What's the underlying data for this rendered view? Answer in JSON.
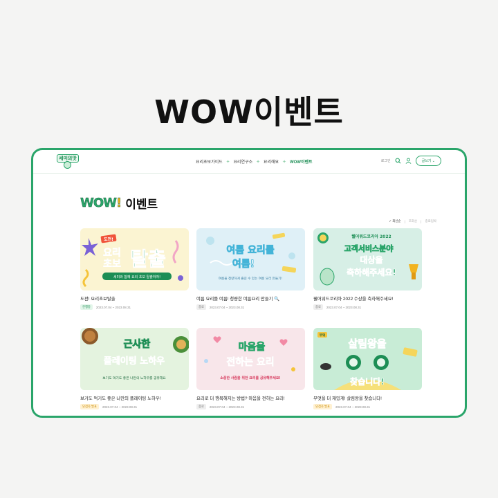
{
  "hero": {
    "title": "WOW이벤트"
  },
  "nav": {
    "logo_text": "세미의맛",
    "menu": [
      {
        "label": "요리초보가이드"
      },
      {
        "label": "요리연구소"
      },
      {
        "label": "요리해요"
      },
      {
        "label": "WOW이벤트"
      }
    ],
    "login": "로그인",
    "cta": "글쓰기"
  },
  "page": {
    "wow_badge": "WOW",
    "wow_ex": "!",
    "title": "이벤트"
  },
  "sort": {
    "options": [
      "최신순",
      "조회순",
      "종료임박"
    ]
  },
  "cards": [
    {
      "title": "도전! 요리초보탈출",
      "status": "진행중",
      "dates": "2023.07.04 ~ 2023.08.31",
      "thumb": {
        "tag": "도전!",
        "line1": "요리",
        "line2": "초보",
        "big": "탈출",
        "sub": "세미와 함께 요리 초보 탈출하자!"
      }
    },
    {
      "title": "여름 요리를 여름! 청량한 여름요리 만들기",
      "status": "종료",
      "dates": "2023.07.04 ~ 2023.08.31",
      "thumb": {
        "line1": "여름 요리를",
        "line2": "여름!",
        "sub": "여름을 청량하게 즐길 수 있는 여름 요리 만들기!"
      }
    },
    {
      "title": "웰어워드코리아 2022 수상을 축하해주세요!",
      "status": "종료",
      "dates": "2023.07.04 ~ 2023.08.31",
      "thumb": {
        "top": "웰어워드코리아 2022",
        "line1": "고객서비스분야",
        "line2": "대상을",
        "line3": "축하해주세요!"
      }
    },
    {
      "title": "보기도 먹기도 좋은 나만의 플레이팅 노하우!",
      "status": "당첨자 발표",
      "dates": "2023.07.04 ~ 2023.08.31",
      "thumb": {
        "line1": "근사한",
        "line2": "플레이팅 노하우",
        "sub": "보기도 먹기도 좋은 나만의 노하우를 공유해요"
      }
    },
    {
      "title": "요리로 더 행복해지는 방법? 마음을 전하는 요리!",
      "status": "종료",
      "dates": "2023.07.04 ~ 2023.08.31",
      "thumb": {
        "line1": "마음을",
        "line2": "전하는 요리",
        "sub": "소중한 사람을 위한 요리를 공유해주세요!"
      }
    },
    {
      "title": "무엇을 더 재밌게! 살림왕을 찾습니다!",
      "status": "당첨자 발표",
      "dates": "2023.07.04 ~ 2023.08.31",
      "thumb": {
        "tag": "부엌",
        "line1": "살림왕을",
        "line2": "찾습니다!"
      }
    }
  ],
  "colors": {
    "brand": "#2aa56a",
    "brand_dark": "#1d8e55",
    "bg": "#f4f4f3"
  }
}
